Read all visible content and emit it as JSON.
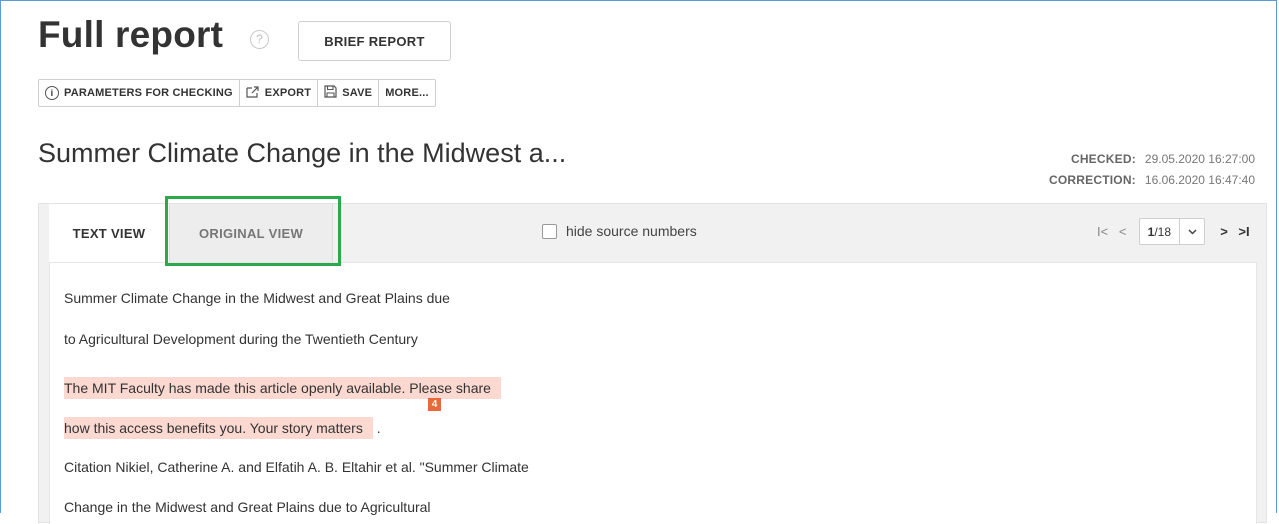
{
  "header": {
    "title": "Full report",
    "help_glyph": "?",
    "brief_report_label": "BRIEF REPORT"
  },
  "toolbar": {
    "parameters_label": "PARAMETERS FOR CHECKING",
    "export_label": "EXPORT",
    "save_label": "SAVE",
    "more_label": "MORE..."
  },
  "document": {
    "title": "Summer Climate Change in the Midwest a...",
    "checked_label": "CHECKED:",
    "checked_value": "29.05.2020 16:27:00",
    "correction_label": "CORRECTION:",
    "correction_value": "16.06.2020 16:47:40"
  },
  "tabs": {
    "text_view": "TEXT VIEW",
    "original_view": "ORIGINAL VIEW"
  },
  "options": {
    "hide_source_numbers": "hide source numbers"
  },
  "pager": {
    "first": "I<",
    "prev": "<",
    "current": "1",
    "total_suffix": "/18",
    "caret": "⌄",
    "next": ">",
    "last": ">I"
  },
  "content": {
    "line1": "Summer Climate Change in the Midwest and Great Plains due",
    "line2": "to Agricultural Development during the Twentieth Century",
    "line3": "The MIT Faculty has made this article openly available. Please share",
    "line4": "how this access benefits you. Your story matters",
    "line4_tail": ".",
    "source_number": "4",
    "line5": "Citation Nikiel, Catherine A. and Elfatih A. B. Eltahir et al. \"Summer Climate",
    "line6": "Change in the Midwest and Great Plains due to Agricultural"
  },
  "colors": {
    "highlight": "#fbd9d0",
    "source_badge": "#e8693c",
    "focus_box": "#2ea84c"
  }
}
